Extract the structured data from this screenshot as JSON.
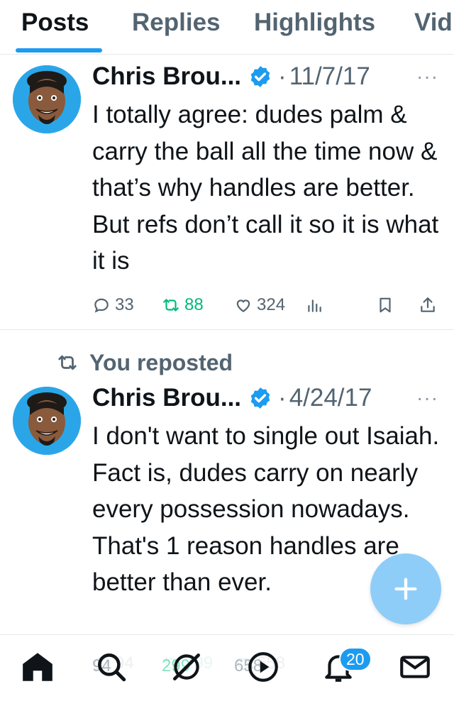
{
  "tabs": [
    {
      "label": "Posts",
      "active": true
    },
    {
      "label": "Replies",
      "active": false
    },
    {
      "label": "Highlights",
      "active": false
    },
    {
      "label": "Vid",
      "active": false
    }
  ],
  "posts": [
    {
      "author": "Chris Brou...",
      "verified": true,
      "separator": "·",
      "date": "11/7/17",
      "more": "···",
      "text": "I totally agree: dudes palm & carry the ball all the time now & that’s why handles are better. But refs don’t call it so it is what it is",
      "replies": "33",
      "reposts": "88",
      "likes": "324"
    },
    {
      "repost_label": "You reposted",
      "author": "Chris Brou...",
      "verified": true,
      "separator": "·",
      "date": "4/24/17",
      "more": "···",
      "text": "I don't want to single out Isaiah. Fact is, dudes carry on nearly every possession nowadays. That's 1 reason handles are better than ever.",
      "replies": "94",
      "reposts": "299",
      "likes": "658"
    }
  ],
  "bottom_nav": {
    "items": [
      "home-icon",
      "search-icon",
      "grok-icon",
      "play-icon",
      "notifications-icon",
      "messages-icon"
    ],
    "notification_badge": "20"
  },
  "colors": {
    "accent": "#1d9bf0",
    "repost": "#00ba7c",
    "muted": "#536471",
    "fab": "#8ecdf8"
  }
}
